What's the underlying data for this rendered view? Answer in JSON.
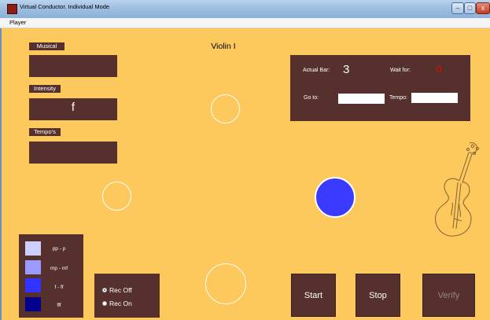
{
  "window": {
    "title": "Virtual Conductor. Individual Mode",
    "minimize": "–",
    "maximize": "□",
    "close": "x"
  },
  "menu": {
    "player": "Player"
  },
  "instrument": {
    "name": "Violin I"
  },
  "left_panels": {
    "musical_label": "Musical",
    "intensity_label": "Intensity",
    "intensity_value": "f",
    "tempos_label": "Tempo's"
  },
  "info_panel": {
    "actual_bar_label": "Actual Bar:",
    "actual_bar_value": "3",
    "wait_for_label": "Wait for:",
    "wait_for_value": "0",
    "go_to_label": "Go to:",
    "tempo_label": "Tempo:"
  },
  "legend": {
    "items": [
      {
        "label": "pp - p",
        "color": "#cfcfff"
      },
      {
        "label": "mp - mf",
        "color": "#9a9aff"
      },
      {
        "label": "f - ff",
        "color": "#3333ff"
      },
      {
        "label": "fff",
        "color": "#00008c"
      }
    ]
  },
  "recording": {
    "rec_off": "Rec Off",
    "rec_on": "Rec On",
    "selected": "Rec Off"
  },
  "buttons": {
    "start": "Start",
    "stop": "Stop",
    "verify": "Verify"
  },
  "colors": {
    "background": "#fdc85c",
    "panel": "#55302c",
    "ball": "#3b3bff"
  },
  "icons": {
    "violin": "violin-outline-icon",
    "app": "matlab-figure-icon"
  }
}
